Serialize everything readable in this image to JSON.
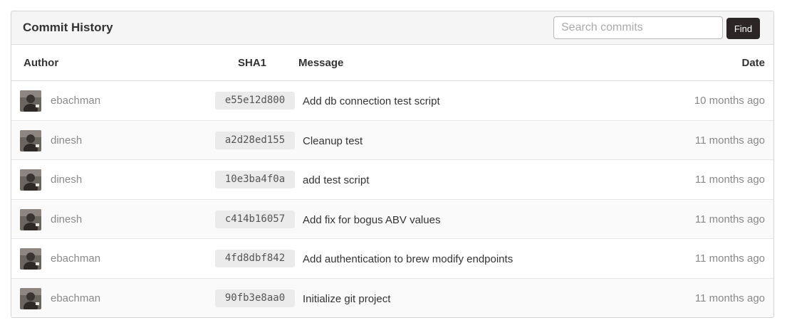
{
  "header": {
    "title": "Commit History",
    "search_placeholder": "Search commits",
    "find_label": "Find"
  },
  "table": {
    "columns": {
      "author": "Author",
      "sha": "SHA1",
      "message": "Message",
      "date": "Date"
    },
    "rows": [
      {
        "author": "ebachman",
        "sha": "e55e12d800",
        "message": "Add db connection test script",
        "date": "10 months ago"
      },
      {
        "author": "dinesh",
        "sha": "a2d28ed155",
        "message": "Cleanup test",
        "date": "11 months ago"
      },
      {
        "author": "dinesh",
        "sha": "10e3ba4f0a",
        "message": "add test script",
        "date": "11 months ago"
      },
      {
        "author": "dinesh",
        "sha": "c414b16057",
        "message": "Add fix for bogus ABV values",
        "date": "11 months ago"
      },
      {
        "author": "ebachman",
        "sha": "4fd8dbf842",
        "message": "Add authentication to brew modify endpoints",
        "date": "11 months ago"
      },
      {
        "author": "ebachman",
        "sha": "90fb3e8aa0",
        "message": "Initialize git project",
        "date": "11 months ago"
      }
    ]
  },
  "colors": {
    "find_button": "#2b2525",
    "sha_badge": "#ebebeb",
    "header_bg": "#f5f5f5"
  }
}
